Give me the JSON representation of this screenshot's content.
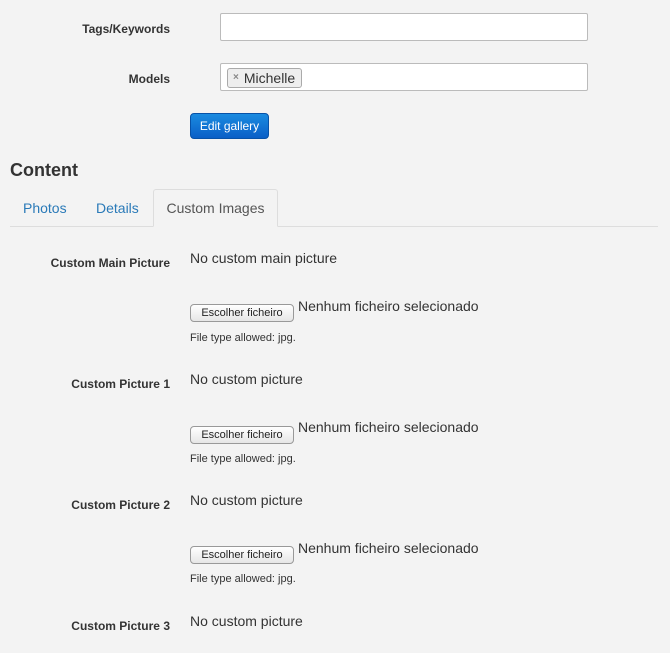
{
  "form": {
    "tags_label": "Tags/Keywords",
    "tags_value": "",
    "models_label": "Models",
    "models_tag": "Michelle",
    "tag_remove": "×",
    "edit_button": "Edit gallery"
  },
  "content": {
    "title": "Content",
    "tabs": [
      {
        "label": "Photos"
      },
      {
        "label": "Details"
      },
      {
        "label": "Custom Images",
        "active": true
      }
    ]
  },
  "custom_images": [
    {
      "label": "Custom Main Picture",
      "status": "No custom main picture",
      "button": "Escolher ficheiro",
      "file_status": "Nenhum ficheiro selecionado",
      "help": "File type allowed: jpg."
    },
    {
      "label": "Custom Picture 1",
      "status": "No custom picture",
      "button": "Escolher ficheiro",
      "file_status": "Nenhum ficheiro selecionado",
      "help": "File type allowed: jpg."
    },
    {
      "label": "Custom Picture 2",
      "status": "No custom picture",
      "button": "Escolher ficheiro",
      "file_status": "Nenhum ficheiro selecionado",
      "help": "File type allowed: jpg."
    },
    {
      "label": "Custom Picture 3",
      "status": "No custom picture"
    }
  ],
  "colors": {
    "link": "#2a7ab8",
    "primary_button": "#0a5fc7",
    "background": "#f3f3f3"
  }
}
